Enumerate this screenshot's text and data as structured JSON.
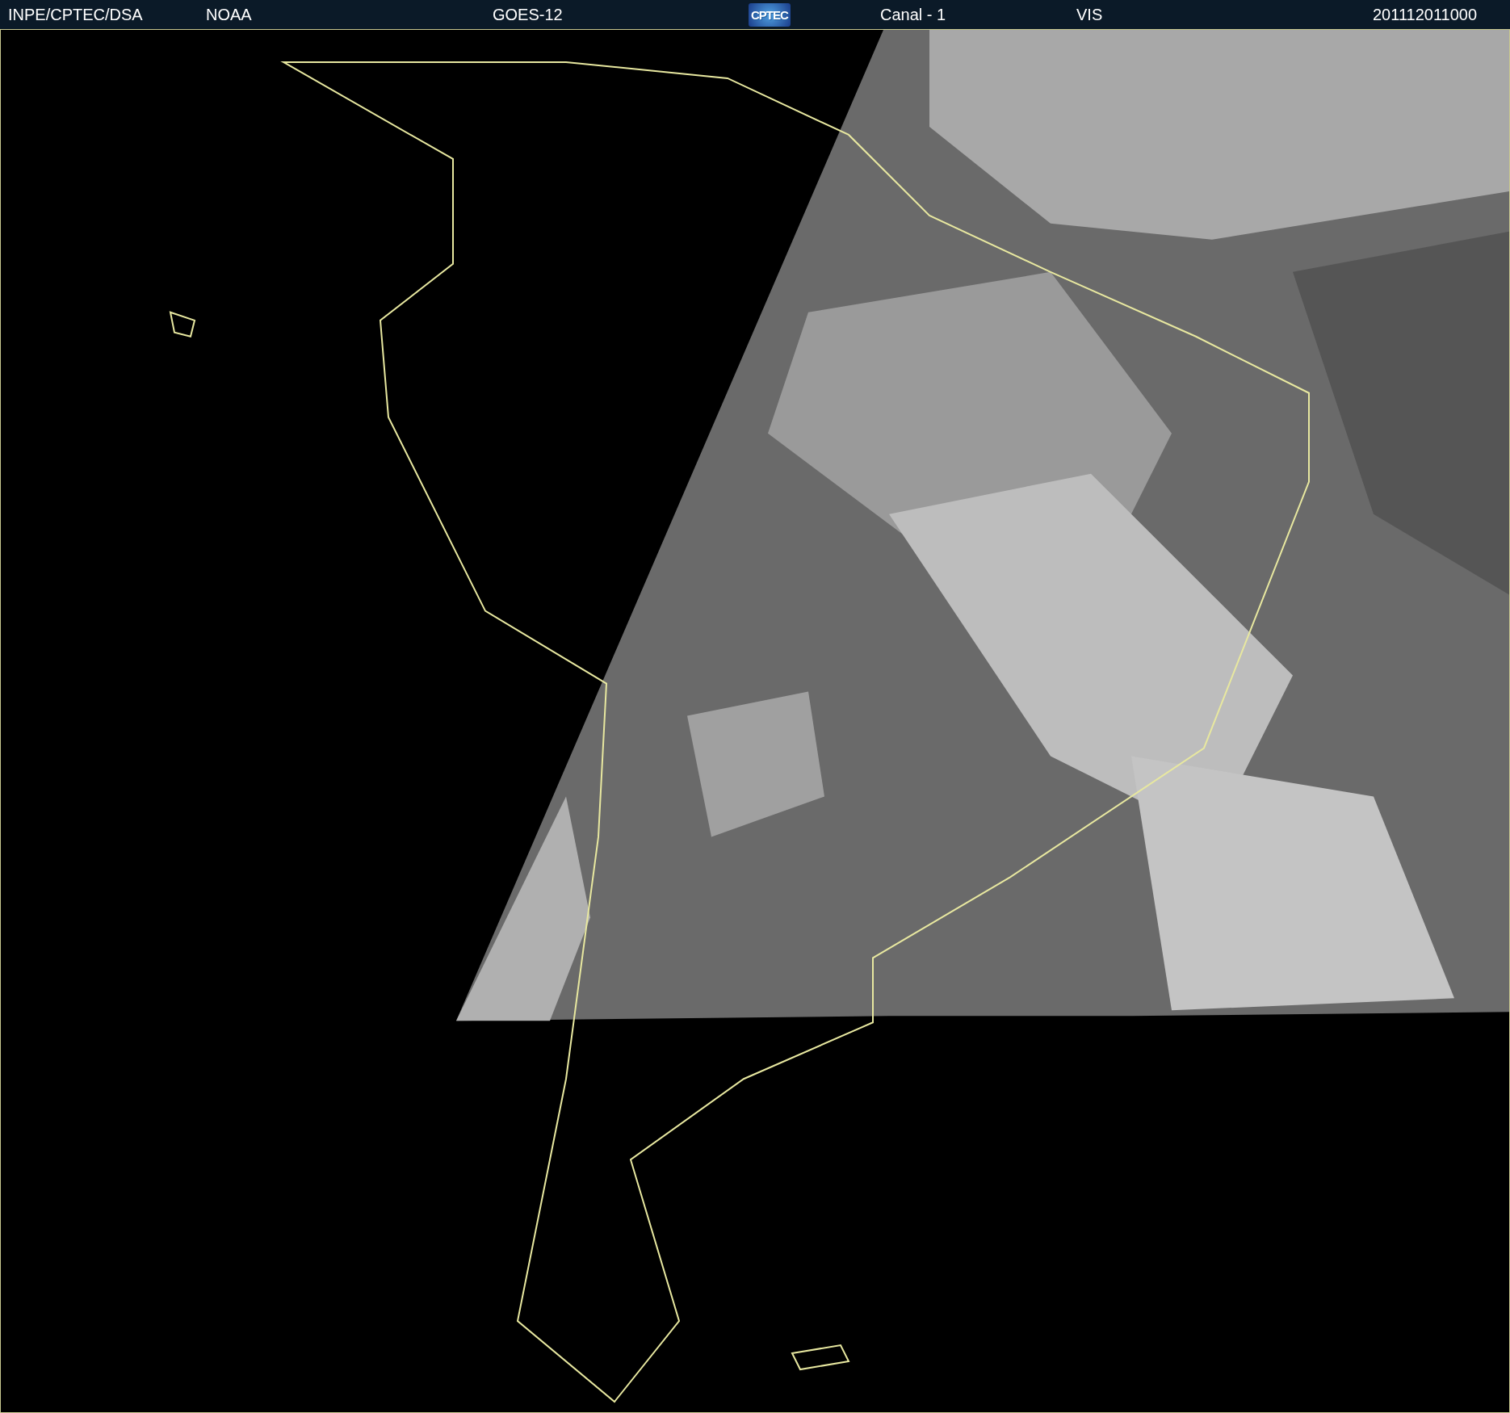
{
  "header": {
    "source": "INPE/CPTEC/DSA",
    "agency": "NOAA",
    "satellite": "GOES-12",
    "logo": "CPTEC",
    "channel": "Canal - 1",
    "band": "VIS",
    "timestamp": "201112011000"
  }
}
